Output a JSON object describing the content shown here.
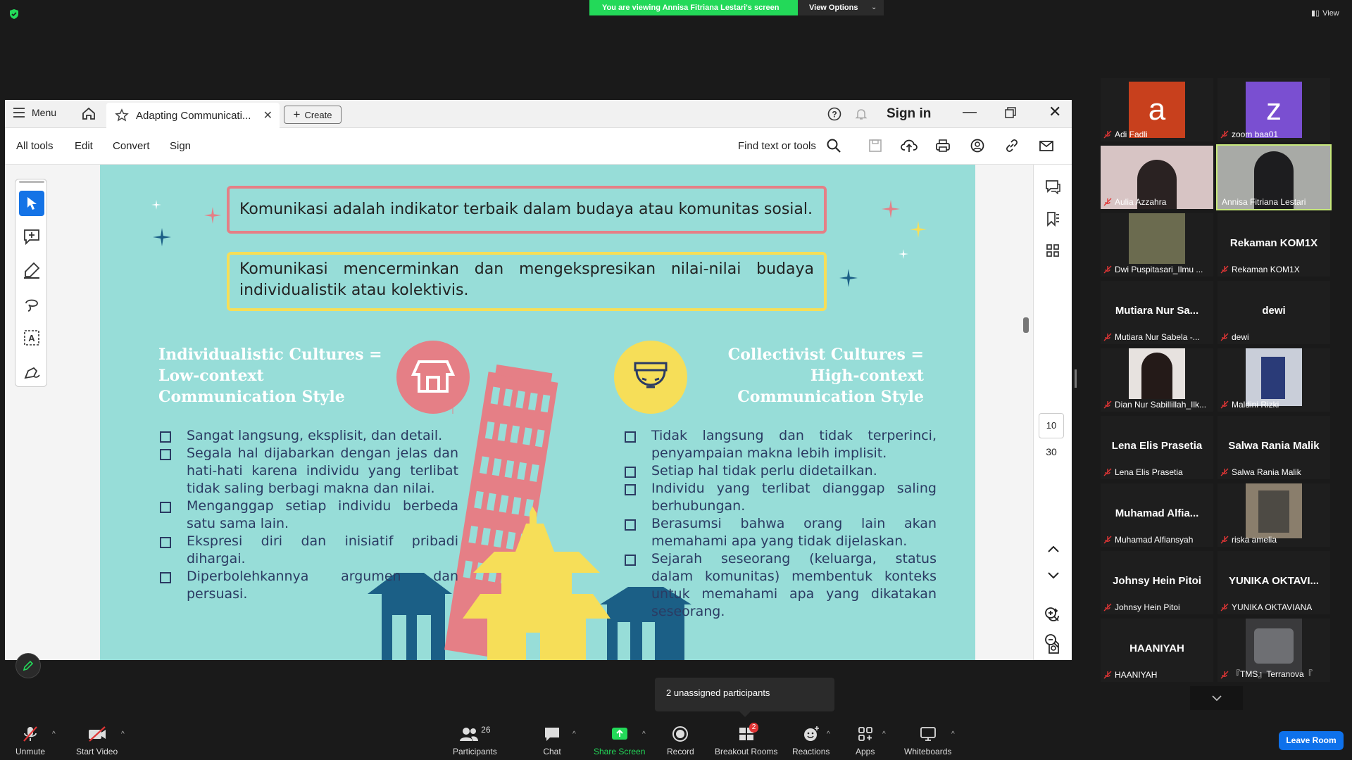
{
  "meeting": {
    "viewing_banner": "You are viewing Annisa Fitriana Lestari's screen",
    "view_options": "View Options",
    "view_button": "View",
    "unassigned_tooltip": "2 unassigned participants"
  },
  "acrobat": {
    "menu": "Menu",
    "tab_title": "Adapting Communicati...",
    "create": "Create",
    "sign_in": "Sign in",
    "toolbar": {
      "all_tools": "All tools",
      "edit": "Edit",
      "convert": "Convert",
      "sign": "Sign",
      "find": "Find text or tools"
    },
    "page_number": "10",
    "page_total": "30"
  },
  "slide": {
    "statement1": "Komunikasi adalah indikator terbaik dalam budaya atau komunitas sosial.",
    "statement2": "Komunikasi mencerminkan dan mengekspresikan nilai-nilai budaya individualistik atau kolektivis.",
    "left_heading": "Individualistic Cultures = Low-context Communication Style",
    "right_heading": "Collectivist Cultures = High-context Communication Style",
    "left_bullets": [
      "Sangat langsung, eksplisit, dan detail.",
      "Segala hal dijabarkan dengan jelas dan hati-hati karena individu yang terlibat tidak saling berbagi makna dan nilai.",
      "Menganggap setiap individu berbeda satu sama lain.",
      "Ekspresi diri dan inisiatif pribadi dihargai.",
      "Diperbolehkannya argumen dan persuasi."
    ],
    "right_bullets": [
      "Tidak langsung dan tidak terperinci, penyampaian makna lebih implisit.",
      "Setiap hal tidak perlu didetailkan.",
      "Individu yang terlibat dianggap saling berhubungan.",
      "Berasumsi bahwa orang lain akan memahami apa yang tidak dijelaskan.",
      "Sejarah seseorang (keluarga, status dalam komunitas) membentuk konteks untuk memahami apa yang dikatakan seseorang."
    ]
  },
  "participants": [
    {
      "name": "Adi Fadli",
      "avatar_letter": "a",
      "avatar_color": "#c8401d"
    },
    {
      "name": "zoom baa01",
      "avatar_letter": "z",
      "avatar_color": "#7a4fd1"
    },
    {
      "name": "Aulia Azzahra"
    },
    {
      "name": "Annisa Fitriana Lestari"
    },
    {
      "name": "Dwi Puspitasari_Ilmu ..."
    },
    {
      "name": "Rekaman KOM1X",
      "display": "Rekaman KOM1X"
    },
    {
      "name": "Mutiara Nur Sabela -...",
      "display": "Mutiara  Nur  Sa..."
    },
    {
      "name": "dewi",
      "display": "dewi"
    },
    {
      "name": "Dian Nur Sabillillah_Ilk..."
    },
    {
      "name": "Maldini Rizki"
    },
    {
      "name": "Lena Elis Prasetia",
      "display": "Lena Elis Prasetia"
    },
    {
      "name": "Salwa Rania Malik",
      "display": "Salwa Rania Malik"
    },
    {
      "name": "Muhamad Alfiansyah",
      "display": "Muhamad  Alfia..."
    },
    {
      "name": "riska amelia"
    },
    {
      "name": "Johnsy Hein Pitoi",
      "display": "Johnsy Hein Pitoi"
    },
    {
      "name": "YUNIKA OKTAVIANA",
      "display": "YUNIKA  OKTAVI..."
    },
    {
      "name": "HAANIYAH",
      "display": "HAANIYAH"
    },
    {
      "name": "『TMS』Terranova『"
    }
  ],
  "controls": {
    "unmute": "Unmute",
    "start_video": "Start Video",
    "participants": "Participants",
    "participants_count": "26",
    "chat": "Chat",
    "share_screen": "Share Screen",
    "record": "Record",
    "breakout_rooms": "Breakout Rooms",
    "breakout_badge": "2",
    "reactions": "Reactions",
    "apps": "Apps",
    "whiteboards": "Whiteboards",
    "leave": "Leave Room"
  },
  "colors": {
    "share_green": "#23d959",
    "leave_blue": "#0e71eb",
    "slide_bg": "#97ddd8",
    "acrobat_blue": "#1473e6"
  }
}
